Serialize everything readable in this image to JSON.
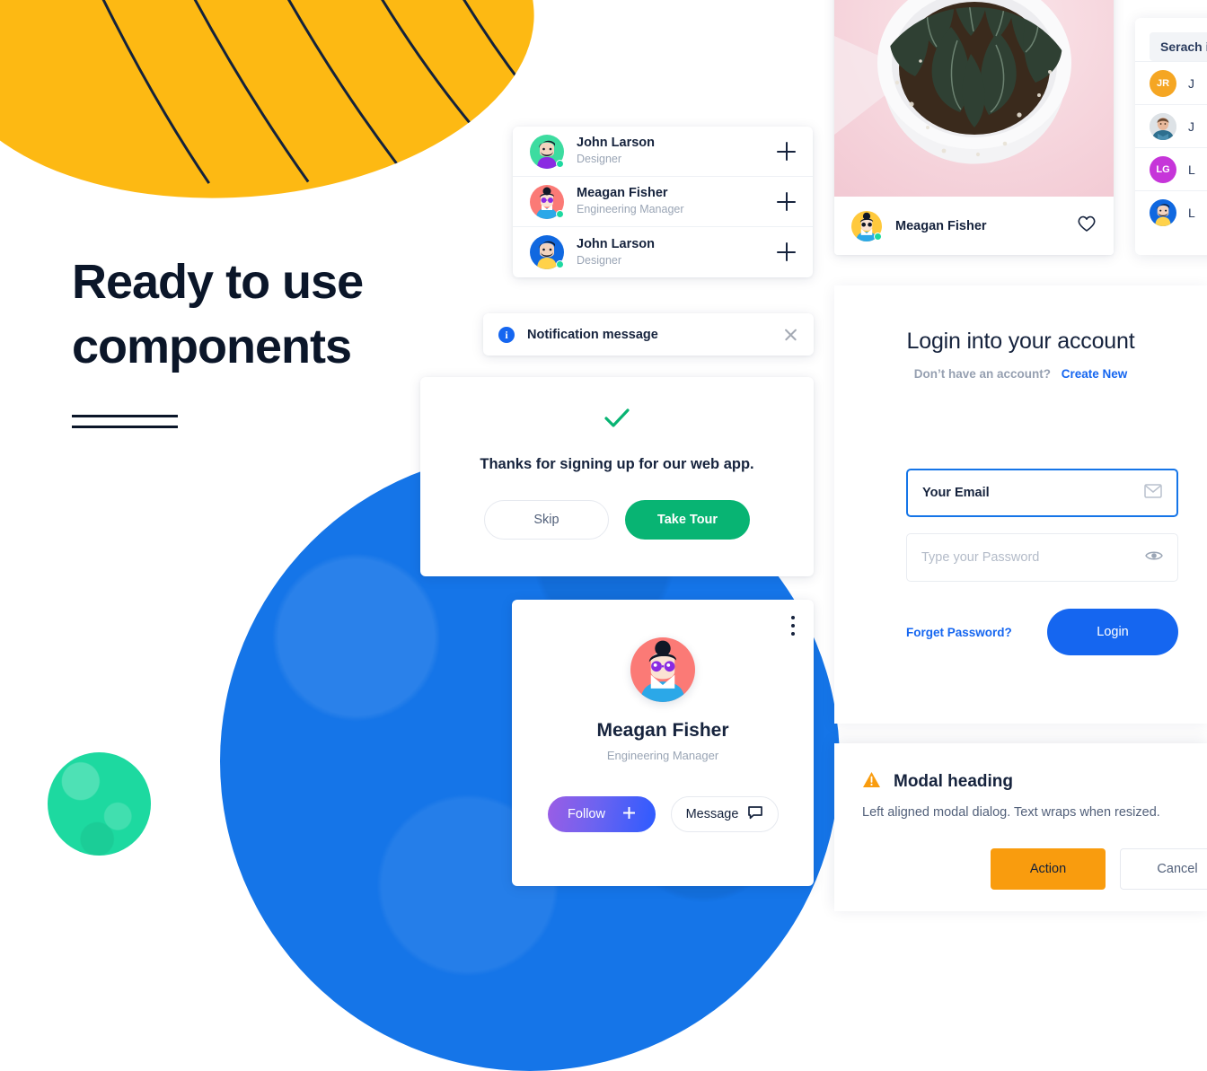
{
  "hero": {
    "headline": "Ready to use components",
    "rule_count": 2
  },
  "colors": {
    "yellow_blob": "#FDB913",
    "green_circle": "#1DD9A0",
    "blue_circle": "#1575E8",
    "primary_blue": "#1566F0",
    "success_green": "#08B473",
    "warning_orange": "#F99C0E",
    "follow_gradient_start": "#9B5DE5",
    "follow_gradient_end": "#2D5BFF",
    "text_dark": "#16233D",
    "text_muted": "#9AA5B5"
  },
  "user_list": {
    "items": [
      {
        "name": "John Larson",
        "role": "Designer",
        "add_label": "+"
      },
      {
        "name": "Meagan Fisher",
        "role": "Engineering Manager",
        "add_label": "+"
      },
      {
        "name": "John Larson",
        "role": "Designer",
        "add_label": "+"
      }
    ]
  },
  "notification": {
    "icon": "info-icon",
    "icon_glyph": "i",
    "message": "Notification message",
    "close_label": "×"
  },
  "success_card": {
    "icon": "check-icon",
    "message": "Thanks for signing up for our web app.",
    "secondary_button": "Skip",
    "primary_button": "Take Tour"
  },
  "profile_card": {
    "menu_icon": "kebab-menu-icon",
    "name": "Meagan Fisher",
    "role": "Engineering Manager",
    "follow_button": "Follow",
    "follow_icon": "plus-icon",
    "message_button": "Message",
    "message_icon": "chat-bubble-icon"
  },
  "photo_card": {
    "image_alt": "succulent plant in white pot on pink background",
    "name": "Meagan Fisher",
    "favorite_icon": "heart-icon"
  },
  "login": {
    "title": "Login into your account",
    "subtitle": "Don’t have an account?",
    "create_link": "Create New",
    "email_value": "Your Email",
    "email_icon": "envelope-icon",
    "password_placeholder": "Type your Password",
    "password_icon": "eye-icon",
    "forget_link": "Forget Password?",
    "submit_button": "Login"
  },
  "modal": {
    "icon": "warning-triangle-icon",
    "heading": "Modal heading",
    "body": "Left aligned modal dialog. Text wraps when resized.",
    "action_button": "Action",
    "cancel_button": "Cancel"
  },
  "search_panel": {
    "search_text": "Serach i",
    "rows": [
      {
        "initials": "JR",
        "avatar_color": "#F5A623",
        "avatar_type": "initials",
        "name": "J"
      },
      {
        "initials": "",
        "avatar_color": "#DCE1E6",
        "avatar_type": "photo",
        "name": "J"
      },
      {
        "initials": "LG",
        "avatar_color": "#C635D9",
        "avatar_type": "initials",
        "name": "L"
      },
      {
        "initials": "",
        "avatar_color": "#1575E8",
        "avatar_type": "illustration",
        "name": "L"
      }
    ]
  }
}
